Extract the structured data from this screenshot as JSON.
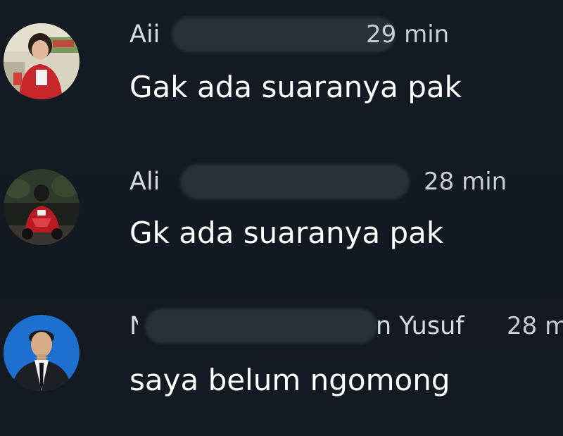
{
  "comments": [
    {
      "author_visible": "Aii",
      "time": "29 min",
      "text": "Gak ada suaranya pak",
      "avatar_icon": "profile-photo-girl-red-shirt"
    },
    {
      "author_visible": "Ali",
      "time": "28 min",
      "text": "Gk ada suaranya pak",
      "avatar_icon": "profile-photo-red-motorcycle"
    },
    {
      "author_prefix": "N",
      "author_suffix": "n Yusuf",
      "time": "28 m",
      "text": "saya belum ngomong",
      "avatar_icon": "profile-photo-man-blue-background"
    }
  ],
  "colors": {
    "background": "#141a22",
    "text_primary": "#ffffff",
    "text_secondary": "#d6dbe1",
    "redaction": "#2a3038"
  }
}
